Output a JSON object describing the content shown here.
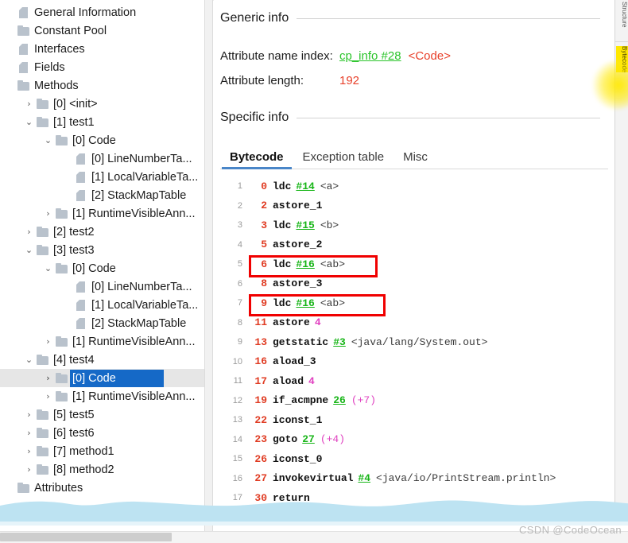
{
  "tree": {
    "items": [
      {
        "twisty": "",
        "icon": "file",
        "indent": 0,
        "label": "General Information",
        "selected": false
      },
      {
        "twisty": "",
        "icon": "folder",
        "indent": 0,
        "label": "Constant Pool",
        "selected": false
      },
      {
        "twisty": "",
        "icon": "file",
        "indent": 0,
        "label": "Interfaces",
        "selected": false
      },
      {
        "twisty": "",
        "icon": "file",
        "indent": 0,
        "label": "Fields",
        "selected": false
      },
      {
        "twisty": "",
        "icon": "folder",
        "indent": 0,
        "label": "Methods",
        "selected": false
      },
      {
        "twisty": ">",
        "icon": "folder",
        "indent": 1,
        "label": "[0] <init>",
        "selected": false
      },
      {
        "twisty": "v",
        "icon": "folder",
        "indent": 1,
        "label": "[1] test1",
        "selected": false
      },
      {
        "twisty": "v",
        "icon": "folder",
        "indent": 2,
        "label": "[0] Code",
        "selected": false
      },
      {
        "twisty": "",
        "icon": "file",
        "indent": 3,
        "label": "[0] LineNumberTa...",
        "selected": false
      },
      {
        "twisty": "",
        "icon": "file",
        "indent": 3,
        "label": "[1] LocalVariableTa...",
        "selected": false
      },
      {
        "twisty": "",
        "icon": "file",
        "indent": 3,
        "label": "[2] StackMapTable",
        "selected": false
      },
      {
        "twisty": ">",
        "icon": "folder",
        "indent": 2,
        "label": "[1] RuntimeVisibleAnn...",
        "selected": false
      },
      {
        "twisty": ">",
        "icon": "folder",
        "indent": 1,
        "label": "[2] test2",
        "selected": false
      },
      {
        "twisty": "v",
        "icon": "folder",
        "indent": 1,
        "label": "[3] test3",
        "selected": false
      },
      {
        "twisty": "v",
        "icon": "folder",
        "indent": 2,
        "label": "[0] Code",
        "selected": false
      },
      {
        "twisty": "",
        "icon": "file",
        "indent": 3,
        "label": "[0] LineNumberTa...",
        "selected": false
      },
      {
        "twisty": "",
        "icon": "file",
        "indent": 3,
        "label": "[1] LocalVariableTa...",
        "selected": false
      },
      {
        "twisty": "",
        "icon": "file",
        "indent": 3,
        "label": "[2] StackMapTable",
        "selected": false
      },
      {
        "twisty": ">",
        "icon": "folder",
        "indent": 2,
        "label": "[1] RuntimeVisibleAnn...",
        "selected": false
      },
      {
        "twisty": "v",
        "icon": "folder",
        "indent": 1,
        "label": "[4] test4",
        "selected": false
      },
      {
        "twisty": ">",
        "icon": "folder",
        "indent": 2,
        "label": "[0] Code",
        "selected": true
      },
      {
        "twisty": ">",
        "icon": "folder",
        "indent": 2,
        "label": "[1] RuntimeVisibleAnn...",
        "selected": false
      },
      {
        "twisty": ">",
        "icon": "folder",
        "indent": 1,
        "label": "[5] test5",
        "selected": false
      },
      {
        "twisty": ">",
        "icon": "folder",
        "indent": 1,
        "label": "[6] test6",
        "selected": false
      },
      {
        "twisty": ">",
        "icon": "folder",
        "indent": 1,
        "label": "[7] method1",
        "selected": false
      },
      {
        "twisty": ">",
        "icon": "folder",
        "indent": 1,
        "label": "[8] method2",
        "selected": false
      },
      {
        "twisty": "",
        "icon": "folder",
        "indent": 0,
        "label": "Attributes",
        "selected": false
      }
    ]
  },
  "detail": {
    "generic_info_title": "Generic info",
    "specific_info_title": "Specific info",
    "attribute_name_index_label": "Attribute name index:",
    "attribute_name_index_link": "cp_info #28",
    "attribute_name_index_value": "<Code>",
    "attribute_length_label": "Attribute length:",
    "attribute_length_value": "192",
    "tabs": [
      {
        "label": "Bytecode",
        "active": true
      },
      {
        "label": "Exception table",
        "active": false
      },
      {
        "label": "Misc",
        "active": false
      }
    ]
  },
  "bytecode": {
    "rows": [
      {
        "line": "1",
        "offset": "0",
        "op": "ldc",
        "ref": "#14",
        "num": "",
        "desc": "<a>",
        "branch": "",
        "delta": "",
        "boxed": 0
      },
      {
        "line": "2",
        "offset": "2",
        "op": "astore_1",
        "ref": "",
        "num": "",
        "desc": "",
        "branch": "",
        "delta": "",
        "boxed": 0
      },
      {
        "line": "3",
        "offset": "3",
        "op": "ldc",
        "ref": "#15",
        "num": "",
        "desc": "<b>",
        "branch": "",
        "delta": "",
        "boxed": 0
      },
      {
        "line": "4",
        "offset": "5",
        "op": "astore_2",
        "ref": "",
        "num": "",
        "desc": "",
        "branch": "",
        "delta": "",
        "boxed": 0
      },
      {
        "line": "5",
        "offset": "6",
        "op": "ldc",
        "ref": "#16",
        "num": "",
        "desc": "<ab>",
        "branch": "",
        "delta": "",
        "boxed": 1
      },
      {
        "line": "6",
        "offset": "8",
        "op": "astore_3",
        "ref": "",
        "num": "",
        "desc": "",
        "branch": "",
        "delta": "",
        "boxed": 0
      },
      {
        "line": "7",
        "offset": "9",
        "op": "ldc",
        "ref": "#16",
        "num": "",
        "desc": "<ab>",
        "branch": "",
        "delta": "",
        "boxed": 2
      },
      {
        "line": "8",
        "offset": "11",
        "op": "astore",
        "ref": "",
        "num": "4",
        "desc": "",
        "branch": "",
        "delta": "",
        "boxed": 0
      },
      {
        "line": "9",
        "offset": "13",
        "op": "getstatic",
        "ref": "#3",
        "num": "",
        "desc": "<java/lang/System.out>",
        "branch": "",
        "delta": "",
        "boxed": 0
      },
      {
        "line": "10",
        "offset": "16",
        "op": "aload_3",
        "ref": "",
        "num": "",
        "desc": "",
        "branch": "",
        "delta": "",
        "boxed": 0
      },
      {
        "line": "11",
        "offset": "17",
        "op": "aload",
        "ref": "",
        "num": "4",
        "desc": "",
        "branch": "",
        "delta": "",
        "boxed": 0
      },
      {
        "line": "12",
        "offset": "19",
        "op": "if_acmpne",
        "ref": "",
        "num": "",
        "desc": "",
        "branch": "26",
        "delta": "(+7)",
        "boxed": 0
      },
      {
        "line": "13",
        "offset": "22",
        "op": "iconst_1",
        "ref": "",
        "num": "",
        "desc": "",
        "branch": "",
        "delta": "",
        "boxed": 0
      },
      {
        "line": "14",
        "offset": "23",
        "op": "goto",
        "ref": "",
        "num": "",
        "desc": "",
        "branch": "27",
        "delta": "(+4)",
        "boxed": 0
      },
      {
        "line": "15",
        "offset": "26",
        "op": "iconst_0",
        "ref": "",
        "num": "",
        "desc": "",
        "branch": "",
        "delta": "",
        "boxed": 0
      },
      {
        "line": "16",
        "offset": "27",
        "op": "invokevirtual",
        "ref": "#4",
        "num": "",
        "desc": "<java/io/PrintStream.println>",
        "branch": "",
        "delta": "",
        "boxed": 0
      },
      {
        "line": "17",
        "offset": "30",
        "op": "return",
        "ref": "",
        "num": "",
        "desc": "",
        "branch": "",
        "delta": "",
        "boxed": 0
      }
    ]
  },
  "edge_strip": {
    "tabs": [
      {
        "label": "Structure",
        "highlighted": false
      },
      {
        "label": "Bytecode",
        "highlighted": true
      }
    ]
  },
  "watermark": "CSDN @CodeOcean",
  "colors": {
    "selection_blue": "#1569c7",
    "link_green": "#2ac42a",
    "value_red": "#e8402a",
    "highlight_box_red": "#f00000",
    "tab_underline_blue": "#4a86c8",
    "wave_blue": "#bde3f2",
    "glow_yellow": "#ffe800"
  }
}
